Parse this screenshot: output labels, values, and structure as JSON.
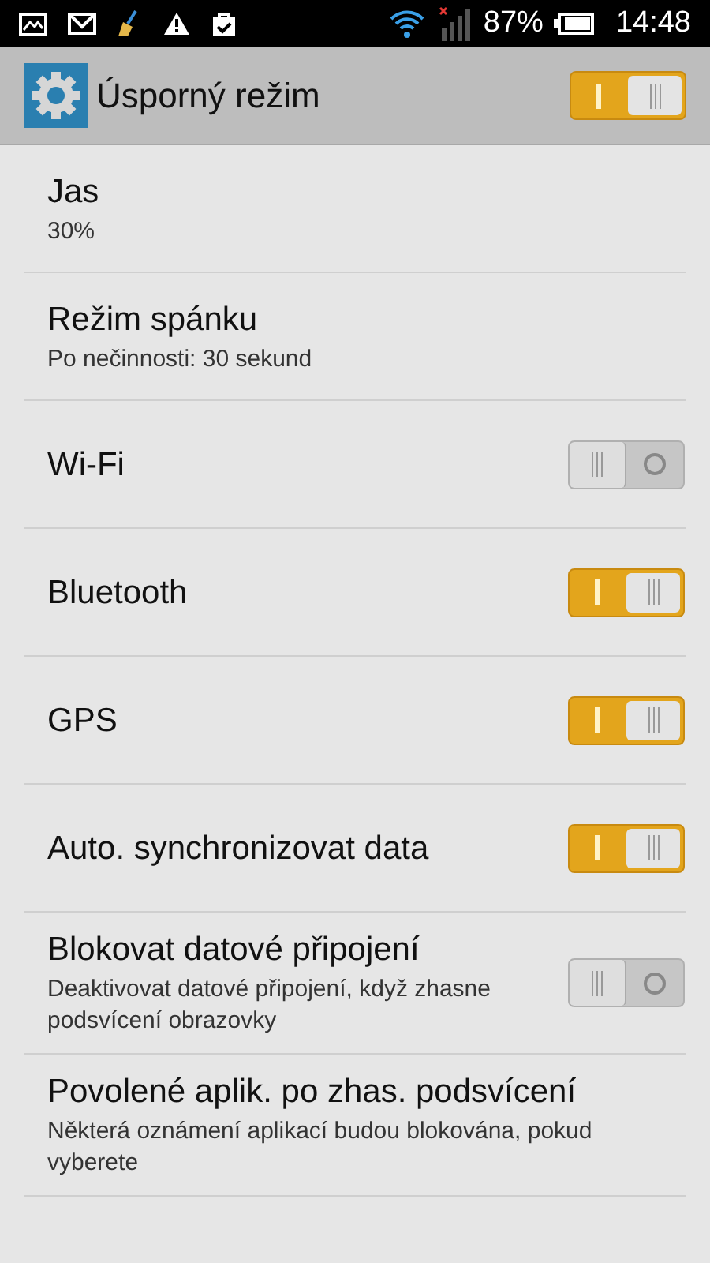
{
  "status_bar": {
    "battery_percent": "87%",
    "time": "14:48"
  },
  "header": {
    "title": "Úsporný režim",
    "on": true
  },
  "items": [
    {
      "kind": "plain",
      "title": "Jas",
      "subtitle": "30%"
    },
    {
      "kind": "plain",
      "title": "Režim spánku",
      "subtitle": "Po nečinnosti: 30 sekund"
    },
    {
      "kind": "toggle",
      "title": "Wi-Fi",
      "on": false
    },
    {
      "kind": "toggle",
      "title": "Bluetooth",
      "on": true
    },
    {
      "kind": "toggle",
      "title": "GPS",
      "on": true
    },
    {
      "kind": "toggle",
      "title": "Auto. synchronizovat data",
      "on": true
    },
    {
      "kind": "toggle",
      "title": "Blokovat datové připojení",
      "subtitle": "Deaktivovat datové připojení, když zhasne podsvícení obrazovky",
      "on": false
    },
    {
      "kind": "plain",
      "title": "Povolené aplik. po zhas. podsvícení",
      "subtitle": "Některá oznámení aplikací budou blokována, pokud vyberete"
    }
  ]
}
